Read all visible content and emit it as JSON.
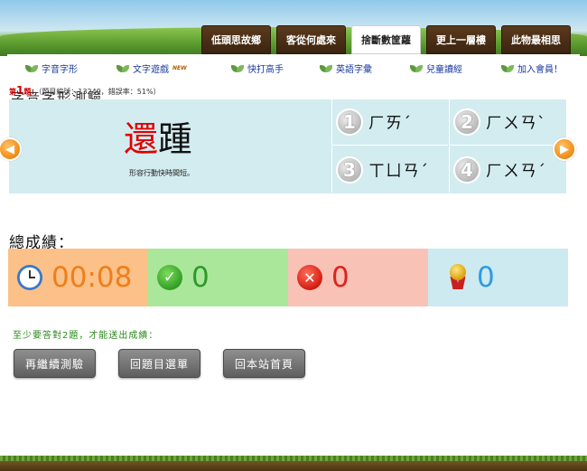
{
  "nav": {
    "tabs": [
      {
        "label": "低頭思故鄉",
        "active": false
      },
      {
        "label": "客從何處來",
        "active": false
      },
      {
        "label": "捨斷數筐蘿",
        "active": true
      },
      {
        "label": "更上一層樓",
        "active": false
      },
      {
        "label": "此物最相思",
        "active": false
      }
    ]
  },
  "subnav": {
    "items": [
      {
        "label": "字音字形"
      },
      {
        "label": "文字遊戲",
        "badge": "NEW"
      },
      {
        "label": "快打高手"
      },
      {
        "label": "英語字彙"
      },
      {
        "label": "兒童讀經"
      },
      {
        "label": "加入會員！"
      }
    ]
  },
  "page": {
    "title": "字音字形測驗"
  },
  "question": {
    "prefix": "第",
    "number": "1",
    "suffix": "題：",
    "meta": "（題目編號：13249，錯誤率：51%）",
    "target_char": "還",
    "other_char": "踵",
    "meaning": "形容行動快時間短。",
    "options": [
      {
        "num": "1",
        "label": "ㄏㄞˊ"
      },
      {
        "num": "2",
        "label": "ㄏㄨㄢˋ"
      },
      {
        "num": "3",
        "label": "ㄒㄩㄢˊ"
      },
      {
        "num": "4",
        "label": "ㄏㄨㄢˊ"
      }
    ]
  },
  "score": {
    "title": "總成績：",
    "time": "00:08",
    "correct": "0",
    "wrong": "0",
    "rank": "0"
  },
  "footer": {
    "hint": "至少要答對2題，才能送出成績：",
    "buttons": [
      "再繼續測驗",
      "回題目選單",
      "回本站首頁"
    ]
  },
  "icons": {
    "prev": "left-arrow-icon",
    "next": "right-arrow-icon",
    "time": "clock-icon",
    "correct": "check-icon",
    "wrong": "x-icon",
    "rank": "medal-icon"
  },
  "colors": {
    "tab_bg": "#3b240f",
    "question_bg": "#d3ecf0",
    "time_bg": "#fbc188",
    "correct_bg": "#abe79a",
    "wrong_bg": "#f8c2b7",
    "rank_bg": "#cdeaf0",
    "target_char": "#e10000"
  }
}
